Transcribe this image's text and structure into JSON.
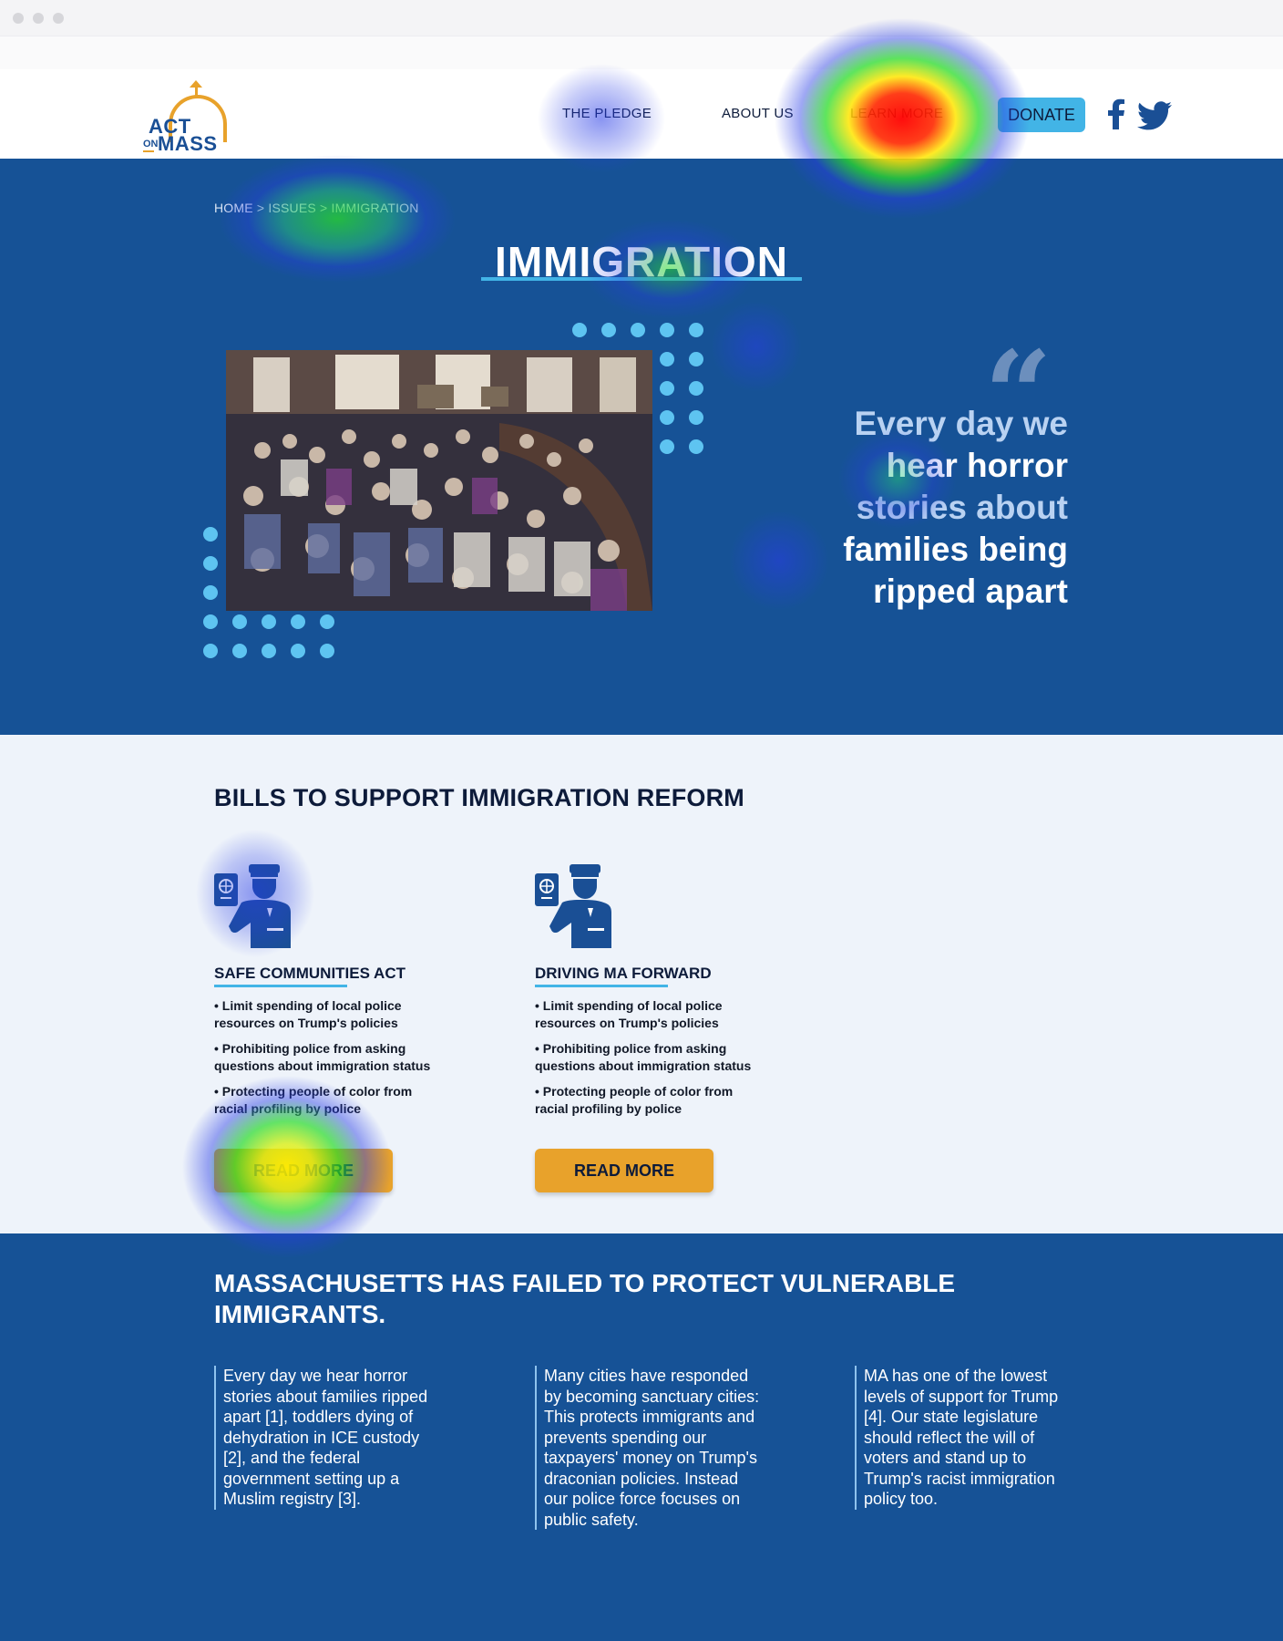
{
  "nav": {
    "logo": {
      "act": "ACT",
      "on": "ON",
      "mass": "MASS"
    },
    "links": [
      "THE PLEDGE",
      "ABOUT US",
      "LEARN MORE"
    ],
    "donate": "DONATE",
    "social": [
      "facebook-icon",
      "twitter-icon"
    ]
  },
  "hero": {
    "breadcrumb": [
      "HOME",
      "ISSUES",
      "IMMIGRATION"
    ],
    "breadcrumb_sep": ">",
    "title": "IMMIGRATION",
    "quote": [
      "Every day we",
      "hear horror",
      "stories about",
      "families being",
      "ripped apart"
    ]
  },
  "bills": {
    "heading": "BILLS TO SUPPORT IMMIGRATION REFORM",
    "items": [
      {
        "title": "SAFE COMMUNITIES ACT",
        "bullets": [
          "• Limit spending of local police resources on Trump's policies",
          "• Prohibiting police from asking questions about immigration status",
          "• Protecting people of color from racial profiling by police"
        ],
        "button": "READ MORE"
      },
      {
        "title": "DRIVING MA FORWARD",
        "bullets": [
          "• Limit spending of local police resources on Trump's policies",
          "• Prohibiting police from asking questions about immigration status",
          "• Protecting people of color from racial profiling by police"
        ],
        "button": "READ MORE"
      }
    ]
  },
  "failure": {
    "heading": "MASSACHUSETTS HAS FAILED TO PROTECT VULNERABLE IMMIGRANTS.",
    "columns": [
      "Every day we hear horror stories about families ripped apart [1], toddlers dying of dehydration in ICE custody [2], and the federal government setting up a Muslim registry [3].",
      "Many cities have responded by becoming sanctuary cities: This protects immigrants and prevents spending our taxpayers' money on Trump's draconian policies. Instead our police force focuses on public safety.",
      "MA has one of the lowest levels of support for Trump [4]. Our state legislature should reflect the will of voters and stand up to Trump's racist immigration policy too."
    ]
  },
  "colors": {
    "brand_blue": "#165296",
    "accent_blue": "#42b4e6",
    "accent_orange": "#e8a22b",
    "dot_blue": "#5ec4f1"
  }
}
